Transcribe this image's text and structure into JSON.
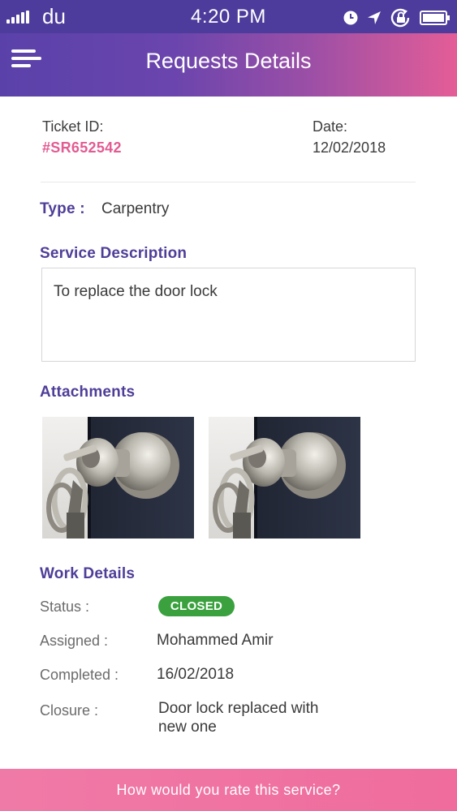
{
  "status_bar": {
    "carrier": "du",
    "time": "4:20 PM",
    "icons": [
      "signal-icon",
      "alarm-clock-icon",
      "location-arrow-icon",
      "rotation-lock-icon",
      "battery-icon"
    ]
  },
  "header": {
    "title": "Requests Details",
    "menu_icon": "hamburger-menu-icon",
    "gradient_colors": [
      "#5a41aa",
      "#e45d97"
    ]
  },
  "ticket": {
    "id_label": "Ticket ID:",
    "id_value": "#SR652542",
    "date_label": "Date:",
    "date_value": "12/02/2018"
  },
  "type": {
    "label": "Type :",
    "value": "Carpentry"
  },
  "service_description": {
    "title": "Service Description",
    "text": "To replace the door lock"
  },
  "attachments": {
    "title": "Attachments",
    "items": [
      "door-lock-photo",
      "door-lock-photo"
    ]
  },
  "work_details": {
    "title": "Work Details",
    "status_label": "Status :",
    "status_value": "CLOSED",
    "status_color": "#3aa13e",
    "assigned_label": "Assigned :",
    "assigned_value": "Mohammed Amir",
    "completed_label": "Completed :",
    "completed_value": "16/02/2018",
    "closure_label": "Closure :",
    "closure_value_line1": "Door lock replaced with",
    "closure_value_line2": "new one"
  },
  "footer": {
    "rate_label": "How would you rate this service?",
    "color": "#ef6c9c"
  },
  "colors": {
    "accent_purple": "#4f3e98",
    "accent_pink": "#e25b92"
  }
}
